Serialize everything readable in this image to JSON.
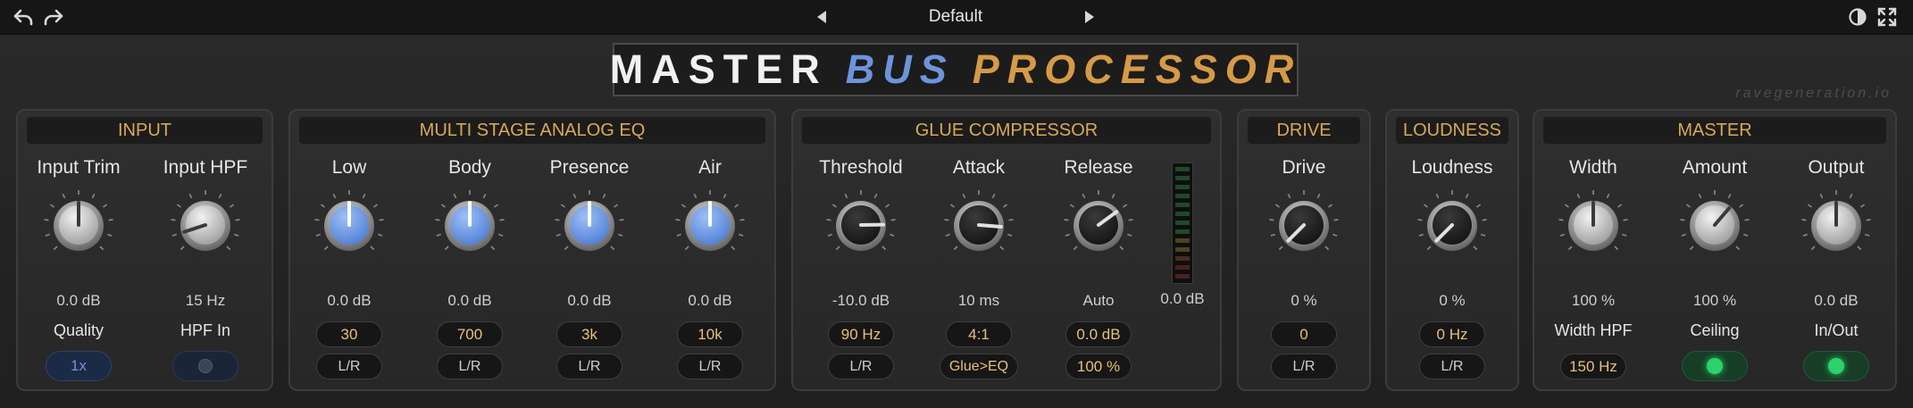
{
  "toolbar": {
    "undo_icon": "undo-icon",
    "redo_icon": "redo-icon",
    "prev_icon": "triangle-left-icon",
    "next_icon": "triangle-right-icon",
    "preset": "Default",
    "theme_icon": "contrast-icon",
    "fullscreen_icon": "expand-icon"
  },
  "title": {
    "word1": "MASTER",
    "word2": "BUS",
    "word3": "PROCESSOR"
  },
  "watermark": "ravegeneration.io",
  "colors": {
    "gold": "#d8a85a",
    "blue": "#6d94db",
    "orange": "#d69a47",
    "led_green": "#2bd36a"
  },
  "input": {
    "title": "INPUT",
    "trim": {
      "label": "Input Trim",
      "value": "0.0 dB",
      "level": 0.5
    },
    "hpf": {
      "label": "Input HPF",
      "value": "15 Hz",
      "level": 0.1
    },
    "quality": {
      "label": "Quality",
      "value": "1x"
    },
    "hpf_in": {
      "label": "HPF In",
      "state": "off"
    }
  },
  "eq": {
    "title": "MULTI STAGE ANALOG EQ",
    "bands": [
      {
        "label": "Low",
        "value": "0.0 dB",
        "freq": "30",
        "mode": "L/R",
        "level": 0.5
      },
      {
        "label": "Body",
        "value": "0.0 dB",
        "freq": "700",
        "mode": "L/R",
        "level": 0.5
      },
      {
        "label": "Presence",
        "value": "0.0 dB",
        "freq": "3k",
        "mode": "L/R",
        "level": 0.5
      },
      {
        "label": "Air",
        "value": "0.0 dB",
        "freq": "10k",
        "mode": "L/R",
        "level": 0.5
      }
    ]
  },
  "comp": {
    "title": "GLUE COMPRESSOR",
    "threshold": {
      "label": "Threshold",
      "value": "-10.0 dB",
      "pill1": "90 Hz",
      "pill2": "L/R",
      "level": 0.83
    },
    "attack": {
      "label": "Attack",
      "value": "10 ms",
      "pill1": "4:1",
      "pill2": "Glue>EQ",
      "level": 0.85
    },
    "release": {
      "label": "Release",
      "value": "Auto",
      "pill1": "0.0 dB",
      "pill2": "100 %",
      "level": 0.7
    },
    "meter_value": "0.0 dB"
  },
  "drive": {
    "title": "DRIVE",
    "label": "Drive",
    "value": "0 %",
    "pill1": "0",
    "pill2": "L/R",
    "level": 0.0
  },
  "loudness": {
    "title": "LOUDNESS",
    "label": "Loudness",
    "value": "0 %",
    "pill1": "0 Hz",
    "pill2": "L/R",
    "level": 0.0
  },
  "master": {
    "title": "MASTER",
    "width": {
      "label": "Width",
      "value": "100 %",
      "sub": "Width HPF",
      "pill": "150 Hz",
      "level": 0.5
    },
    "amount": {
      "label": "Amount",
      "value": "100 %",
      "sub": "Ceiling",
      "state": "on",
      "level": 0.65
    },
    "output": {
      "label": "Output",
      "value": "0.0 dB",
      "sub": "In/Out",
      "state": "on",
      "level": 0.5
    }
  }
}
